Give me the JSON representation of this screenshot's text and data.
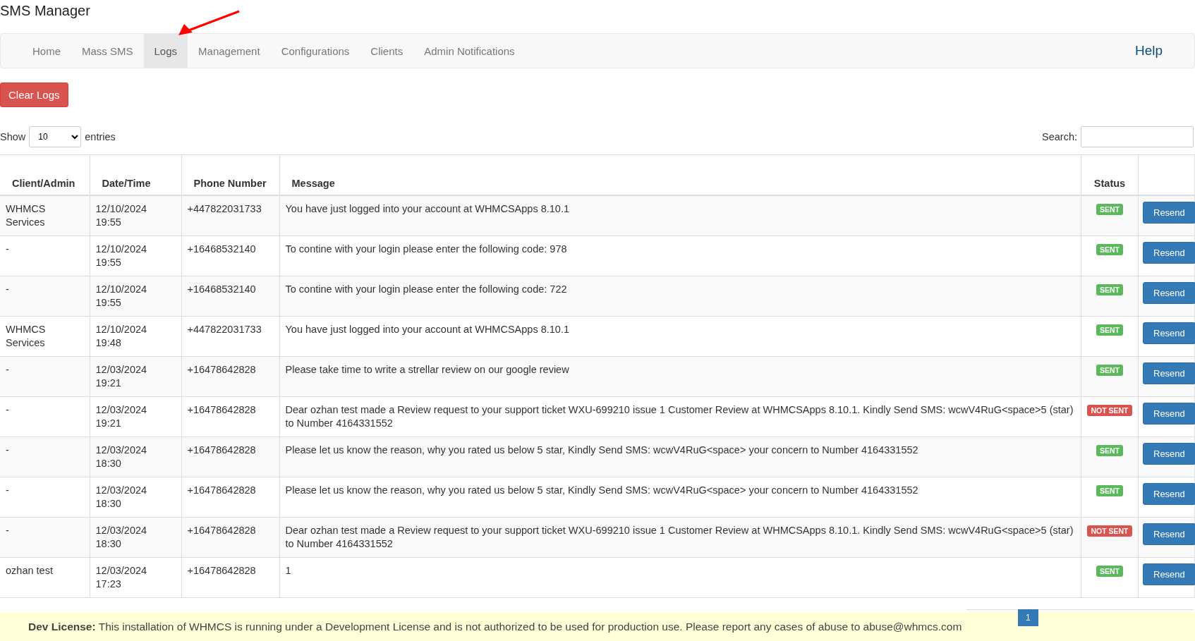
{
  "title": "SMS Manager",
  "nav": {
    "tabs": [
      {
        "label": "Home",
        "selected": false
      },
      {
        "label": "Mass SMS",
        "selected": false
      },
      {
        "label": "Logs",
        "selected": true
      },
      {
        "label": "Management",
        "selected": false
      },
      {
        "label": "Configurations",
        "selected": false
      },
      {
        "label": "Clients",
        "selected": false
      },
      {
        "label": "Admin Notifications",
        "selected": false
      }
    ],
    "help": "Help"
  },
  "clear_button": "Clear Logs",
  "length": {
    "before": "Show",
    "value": "10",
    "after": "entries"
  },
  "search": {
    "label": "Search:"
  },
  "table": {
    "columns": [
      "Client/Admin",
      "Date/Time",
      "Phone Number",
      "Message",
      "Status"
    ],
    "rows": [
      {
        "client": "WHMCS Services",
        "date": "12/10/2024",
        "time": "19:55",
        "phone": "+447822031733",
        "message": "You have just logged into your account at WHMCSApps 8.10.1",
        "status": {
          "label": "SENT",
          "kind": "sent"
        },
        "action": "Resend"
      },
      {
        "client": "-",
        "date": "12/10/2024",
        "time": "19:55",
        "phone": "+16468532140",
        "message": "To contine with your login please enter the following code: 978",
        "status": {
          "label": "SENT",
          "kind": "sent"
        },
        "action": "Resend"
      },
      {
        "client": "-",
        "date": "12/10/2024",
        "time": "19:55",
        "phone": "+16468532140",
        "message": "To contine with your login please enter the following code: 722",
        "status": {
          "label": "SENT",
          "kind": "sent"
        },
        "action": "Resend"
      },
      {
        "client": "WHMCS Services",
        "date": "12/10/2024",
        "time": "19:48",
        "phone": "+447822031733",
        "message": "You have just logged into your account at WHMCSApps 8.10.1",
        "status": {
          "label": "SENT",
          "kind": "sent"
        },
        "action": "Resend"
      },
      {
        "client": "-",
        "date": "12/03/2024",
        "time": "19:21",
        "phone": "+16478642828",
        "message": "Please take time to write a strellar review on our google review",
        "status": {
          "label": "SENT",
          "kind": "sent"
        },
        "action": "Resend"
      },
      {
        "client": "-",
        "date": "12/03/2024",
        "time": "19:21",
        "phone": "+16478642828",
        "message": "Dear ozhan test made a Review request to your support ticket WXU-699210 issue 1 Customer Review at WHMCSApps 8.10.1. Kindly Send SMS: wcwV4RuG<space>5 (star) to Number 4164331552",
        "status": {
          "label": "NOT SENT",
          "kind": "not_sent"
        },
        "action": "Resend"
      },
      {
        "client": "-",
        "date": "12/03/2024",
        "time": "18:30",
        "phone": "+16478642828",
        "message": "Please let us know the reason, why you rated us below 5 star, Kindly Send SMS: wcwV4RuG<space> your concern to Number 4164331552",
        "status": {
          "label": "SENT",
          "kind": "sent"
        },
        "action": "Resend"
      },
      {
        "client": "-",
        "date": "12/03/2024",
        "time": "18:30",
        "phone": "+16478642828",
        "message": "Please let us know the reason, why you rated us below 5 star, Kindly Send SMS: wcwV4RuG<space> your concern to Number 4164331552",
        "status": {
          "label": "SENT",
          "kind": "sent"
        },
        "action": "Resend"
      },
      {
        "client": "-",
        "date": "12/03/2024",
        "time": "18:30",
        "phone": "+16478642828",
        "message": "Dear ozhan test made a Review request to your support ticket WXU-699210 issue 1 Customer Review at WHMCSApps 8.10.1. Kindly Send SMS: wcwV4RuG<space>5 (star) to Number 4164331552",
        "status": {
          "label": "NOT SENT",
          "kind": "not_sent"
        },
        "action": "Resend"
      },
      {
        "client": "ozhan test",
        "date": "12/03/2024",
        "time": "17:23",
        "phone": "+16478642828",
        "message": "1",
        "status": {
          "label": "SENT",
          "kind": "sent"
        },
        "action": "Resend"
      }
    ]
  },
  "pagination": {
    "pages": [
      {
        "label": "1",
        "selected": true
      }
    ]
  },
  "license": {
    "text": "**Dev License:** This installation of WHMCS is running under a Development License and is not authorized to be used for production use. Please report any cases of abuse to abuse@whmcs.com"
  }
}
